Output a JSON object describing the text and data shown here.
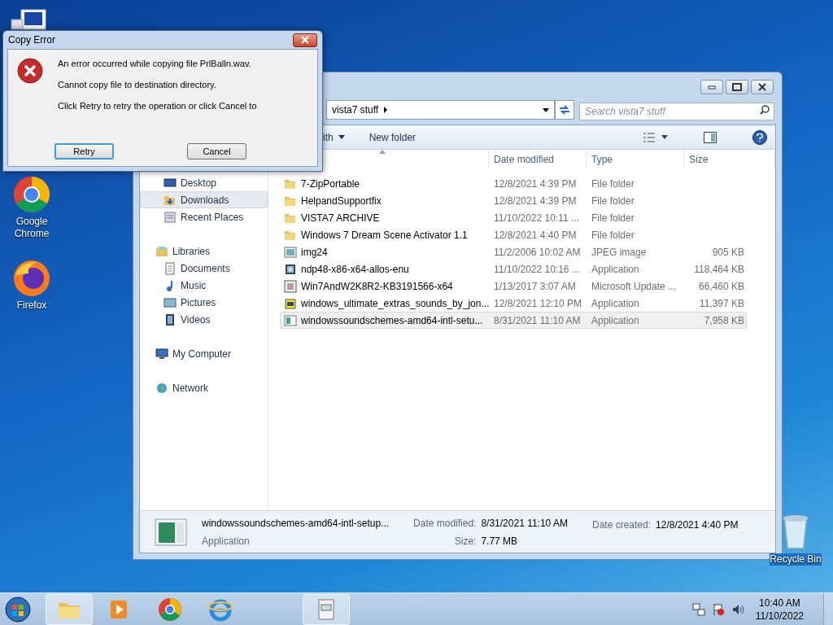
{
  "desktop_icons": [
    {
      "label": "Google Chrome",
      "kind": "chrome"
    },
    {
      "label": "Firefox",
      "kind": "firefox"
    },
    {
      "label": "Recycle Bin",
      "kind": "bin"
    }
  ],
  "explorer": {
    "breadcrumb": "vista7 stuff",
    "search_placeholder": "Search vista7 stuff",
    "toolbar": [
      {
        "label": "ith",
        "menu": true
      },
      {
        "label": "New folder",
        "menu": false
      }
    ],
    "columns": [
      "Date modified",
      "Type",
      "Size"
    ],
    "nav": [
      {
        "children": [
          {
            "label": "Desktop",
            "kind": "desktop",
            "selected": false
          },
          {
            "label": "Downloads",
            "kind": "downloads",
            "selected": true
          },
          {
            "label": "Recent Places",
            "kind": "recent",
            "selected": false
          }
        ]
      },
      {
        "label": "Libraries",
        "kind": "libraries",
        "selected": false,
        "children": [
          {
            "label": "Documents",
            "kind": "documents",
            "selected": false
          },
          {
            "label": "Music",
            "kind": "music",
            "selected": false
          },
          {
            "label": "Pictures",
            "kind": "pictures",
            "selected": false
          },
          {
            "label": "Videos",
            "kind": "videos",
            "selected": false
          }
        ]
      },
      {
        "label": "My Computer",
        "kind": "computer",
        "selected": false
      },
      {
        "label": "Network",
        "kind": "network",
        "selected": false
      }
    ],
    "files": [
      {
        "name": "7-ZipPortable",
        "date": "12/8/2021 4:39 PM",
        "type": "File folder",
        "kind": "folder",
        "selected": false
      },
      {
        "name": "HelpandSupportfix",
        "date": "12/8/2021 4:39 PM",
        "type": "File folder",
        "kind": "folder",
        "selected": false
      },
      {
        "name": "VISTA7 ARCHIVE",
        "date": "11/10/2022 10:11 ...",
        "type": "File folder",
        "kind": "folder",
        "selected": false
      },
      {
        "name": "Windows 7 Dream Scene Activator 1.1",
        "date": "12/8/2021 4:40 PM",
        "type": "File folder",
        "kind": "folder",
        "selected": false
      },
      {
        "name": "img24",
        "date": "11/2/2006 10:02 AM",
        "type": "JPEG image",
        "size": "905 KB",
        "kind": "image",
        "selected": false
      },
      {
        "name": "ndp48-x86-x64-allos-enu",
        "date": "11/10/2022 10:16 ...",
        "type": "Application",
        "size": "118,464 KB",
        "kind": "installer",
        "selected": false
      },
      {
        "name": "Win7AndW2K8R2-KB3191566-x64",
        "date": "1/13/2017 3:07 AM",
        "type": "Microsoft Update ...",
        "size": "66,460 KB",
        "kind": "update",
        "selected": false
      },
      {
        "name": "windows_ultimate_extras_sounds_by_jon...",
        "date": "12/8/2021 12:10 PM",
        "type": "Application",
        "size": "11,397 KB",
        "kind": "setup",
        "selected": false
      },
      {
        "name": "windowssoundschemes-amd64-intl-setu...",
        "date": "8/31/2021 11:10 AM",
        "type": "Application",
        "size": "7,958 KB",
        "kind": "app",
        "selected": true
      }
    ],
    "details": {
      "name": "windowssoundschemes-amd64-intl-setup...",
      "type": "Application",
      "modified_label": "Date modified:",
      "modified": "8/31/2021 11:10 AM",
      "size_label": "Size:",
      "size": "7.77 MB",
      "created_label": "Date created:",
      "created": "12/8/2021 4:40 PM"
    }
  },
  "dialog": {
    "title": "Copy Error",
    "messages": [
      "An error occurred while copying file PrlBalln.wav.",
      "Cannot copy file to destination directory.",
      "Click Retry to retry the operation or click Cancel to"
    ],
    "buttons": [
      {
        "label": "Retry",
        "default": true
      },
      {
        "label": "Cancel",
        "default": false
      }
    ]
  },
  "taskbar": {
    "items": [
      {
        "kind": "explorer",
        "active": true
      },
      {
        "kind": "media",
        "active": false
      },
      {
        "kind": "chrome",
        "active": false
      },
      {
        "kind": "ie",
        "active": false
      },
      {
        "kind": "app",
        "active": true
      }
    ],
    "time": "10:40 AM",
    "date": "11/10/2022"
  }
}
